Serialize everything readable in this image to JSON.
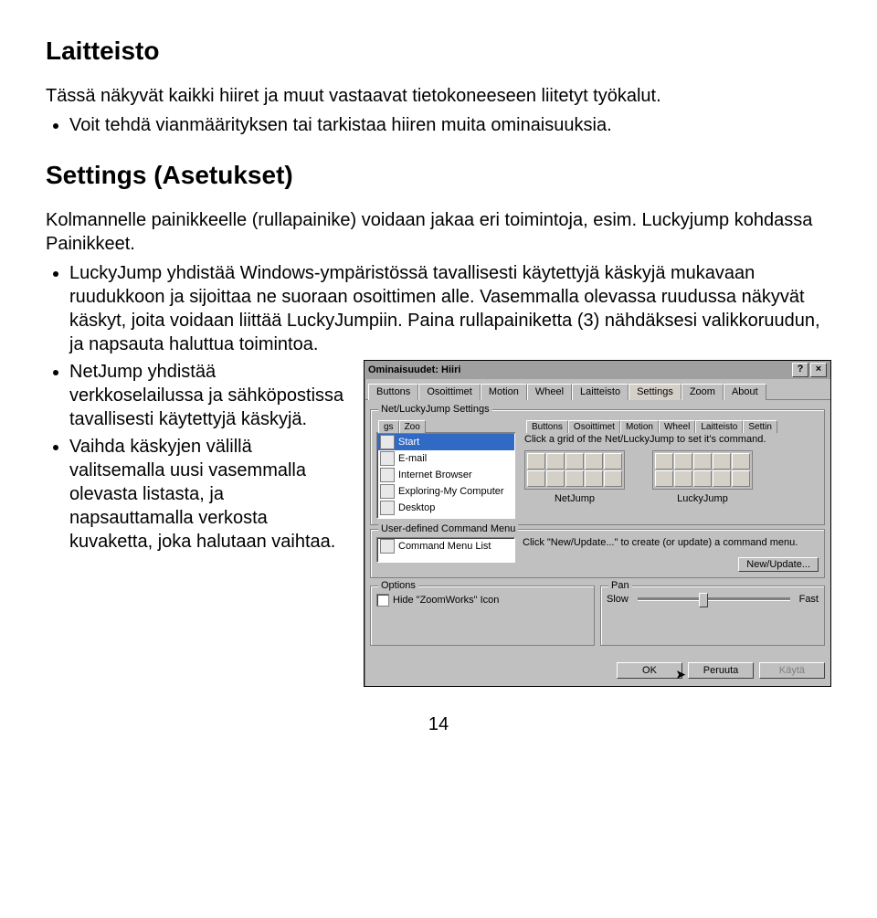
{
  "section1": {
    "title": "Laitteisto",
    "intro": "Tässä näkyvät kaikki hiiret ja muut vastaavat tietokoneeseen liitetyt työkalut.",
    "bullet": "Voit tehdä vianmäärityksen tai tarkistaa hiiren muita ominaisuuksia."
  },
  "section2": {
    "title": "Settings (Asetukset)",
    "intro": "Kolmannelle painikkeelle (rullapainike) voidaan jakaa eri toimintoja, esim. Luckyjump kohdassa Painikkeet.",
    "bullets": [
      "LuckyJump yhdistää Windows-ympäristössä tavallisesti käytettyjä käskyjä mukavaan ruudukkoon ja sijoittaa ne suoraan osoittimen alle. Vasemmalla olevassa ruudussa näkyvät käskyt, joita voidaan liittää LuckyJumpiin. Paina rullapainiketta (3) nähdäksesi valikkoruudun, ja napsauta haluttua toimintoa.",
      "NetJump yhdistää verkkoselailussa ja sähköpostissa tavallisesti käytettyjä käskyjä.",
      "Vaihda käskyjen välillä valitsemalla uusi vasemmalla olevasta listasta, ja napsauttamalla verkosta kuvaketta, joka halutaan vaihtaa."
    ]
  },
  "dialog": {
    "title": "Ominaisuudet: Hiiri",
    "tabs": [
      "Buttons",
      "Osoittimet",
      "Motion",
      "Wheel",
      "Laitteisto",
      "Settings",
      "Zoom",
      "About"
    ],
    "inner_tabs_left": [
      "gs",
      "Zoo"
    ],
    "inner_tabs_right": [
      "Buttons",
      "Osoittimet",
      "Motion",
      "Wheel",
      "Laitteisto",
      "Settin"
    ],
    "group_nlj": {
      "title": "Net/LuckyJump Settings",
      "hint": "Click a grid of the Net/LuckyJump to set it's command.",
      "list": [
        "Start",
        "E-mail",
        "Internet Browser",
        "Exploring-My Computer",
        "Desktop"
      ],
      "net_label": "NetJump",
      "lucky_label": "LuckyJump"
    },
    "group_cmd": {
      "title": "User-defined Command Menu",
      "item": "Command Menu List",
      "hint": "Click \"New/Update...\" to create (or update) a command menu.",
      "btn": "New/Update..."
    },
    "group_opts": {
      "title": "Options",
      "check": "Hide \"ZoomWorks\" Icon"
    },
    "group_pan": {
      "title": "Pan",
      "slow": "Slow",
      "fast": "Fast"
    },
    "buttons": {
      "ok": "OK",
      "cancel": "Peruuta",
      "apply": "Käytä"
    }
  },
  "page_number": "14"
}
